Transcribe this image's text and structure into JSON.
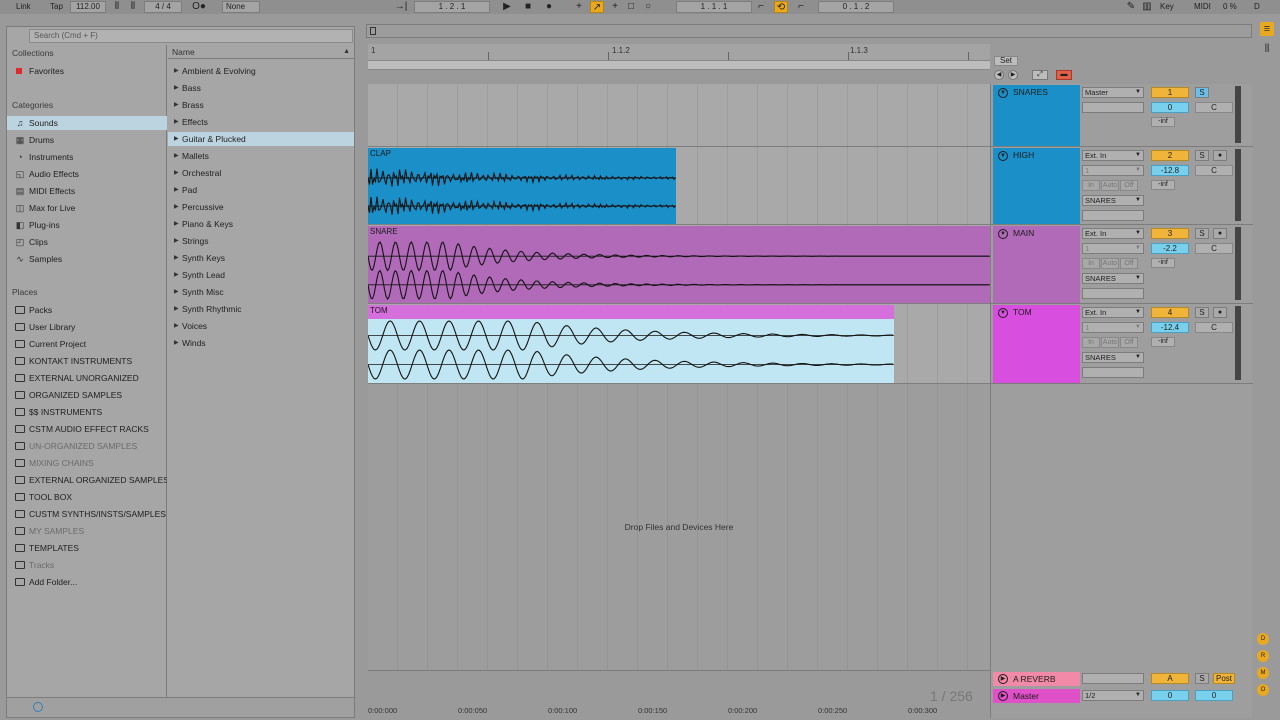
{
  "transport": {
    "link": "Link",
    "tap": "Tap",
    "tempo": "112.00",
    "signature": "4 / 4",
    "metronome": "None",
    "position": "1 .   2 .   1",
    "loop_start": "1 .   1 .   1",
    "loop_length": "0 .   1 .   2",
    "key": "Key",
    "midi": "MIDI",
    "cpu": "0 %",
    "disk": "D"
  },
  "browser": {
    "search_placeholder": "Search (Cmd + F)",
    "collections_title": "Collections",
    "favorites": "Favorites",
    "categories_title": "Categories",
    "categories": [
      {
        "label": "Sounds",
        "icon": "music-note-icon"
      },
      {
        "label": "Drums",
        "icon": "drum-grid-icon"
      },
      {
        "label": "Instruments",
        "icon": "instrument-icon"
      },
      {
        "label": "Audio Effects",
        "icon": "audio-effect-icon"
      },
      {
        "label": "MIDI Effects",
        "icon": "midi-effect-icon"
      },
      {
        "label": "Max for Live",
        "icon": "max-icon"
      },
      {
        "label": "Plug-ins",
        "icon": "plugin-icon"
      },
      {
        "label": "Clips",
        "icon": "clip-icon"
      },
      {
        "label": "Samples",
        "icon": "waveform-icon"
      }
    ],
    "places_title": "Places",
    "places": [
      {
        "label": "Packs",
        "dim": false
      },
      {
        "label": "User Library",
        "dim": false
      },
      {
        "label": "Current Project",
        "dim": false
      },
      {
        "label": "KONTAKT INSTRUMENTS",
        "dim": false
      },
      {
        "label": "EXTERNAL UNORGANIZED",
        "dim": false
      },
      {
        "label": "ORGANIZED SAMPLES",
        "dim": false
      },
      {
        "label": "$$ INSTRUMENTS",
        "dim": false
      },
      {
        "label": "CSTM AUDIO EFFECT RACKS",
        "dim": false
      },
      {
        "label": "UN-ORGANIZED SAMPLES",
        "dim": true
      },
      {
        "label": "MIXING CHAINS",
        "dim": true
      },
      {
        "label": "EXTERNAL ORGANIZED SAMPLES",
        "dim": false
      },
      {
        "label": "TOOL BOX",
        "dim": false
      },
      {
        "label": "CUSTM SYNTHS/INSTS/SAMPLES",
        "dim": false
      },
      {
        "label": "MY SAMPLES",
        "dim": true
      },
      {
        "label": "TEMPLATES",
        "dim": false
      },
      {
        "label": "Tracks",
        "dim": true
      },
      {
        "label": "Add Folder...",
        "dim": false
      }
    ],
    "name_header": "Name",
    "names": [
      "Ambient & Evolving",
      "Bass",
      "Brass",
      "Effects",
      "Guitar & Plucked",
      "Mallets",
      "Orchestral",
      "Pad",
      "Percussive",
      "Piano & Keys",
      "Strings",
      "Synth Keys",
      "Synth Lead",
      "Synth Misc",
      "Synth Rhythmic",
      "Voices",
      "Winds"
    ],
    "selected_name": "Guitar & Plucked",
    "selected_category": "Sounds"
  },
  "arrangement": {
    "ruler": [
      "1",
      "1.1.2",
      "1.1.3"
    ],
    "set_label": "Set",
    "drop_hint": "Drop Files and Devices Here",
    "zoom_readout": "1 / 256",
    "time_labels": [
      "0:00:000",
      "0:00:050",
      "0:00:100",
      "0:00:150",
      "0:00:200",
      "0:00:250",
      "0:00:300"
    ],
    "clips": [
      {
        "name": "CLAP",
        "color": "#1a8fc8"
      },
      {
        "name": "SNARE",
        "color": "#b06ab8"
      },
      {
        "name": "TOM",
        "color": "#d46fdc"
      }
    ]
  },
  "tracks": [
    {
      "name": "SNARES",
      "color": "#1a8fc8",
      "input": "Master",
      "input2": "",
      "output": "",
      "number": "1",
      "volume": "0",
      "pan": "C",
      "send": "-inf",
      "solo_on": true
    },
    {
      "name": "HIGH",
      "color": "#1a8fc8",
      "input": "Ext. In",
      "input2": "1",
      "output": "SNARES",
      "number": "2",
      "volume": "-12.8",
      "pan": "C",
      "send": "-inf",
      "solo_on": false
    },
    {
      "name": "MAIN",
      "color": "#b06ab8",
      "input": "Ext. In",
      "input2": "1",
      "output": "SNARES",
      "number": "3",
      "volume": "-2.2",
      "pan": "C",
      "send": "-inf",
      "solo_on": false
    },
    {
      "name": "TOM",
      "color": "#d84fe0",
      "input": "Ext. In",
      "input2": "1",
      "output": "SNARES",
      "number": "4",
      "volume": "-12.4",
      "pan": "C",
      "send": "-inf",
      "solo_on": false
    }
  ],
  "monitor": {
    "in": "In",
    "auto": "Auto",
    "off": "Off"
  },
  "returns": {
    "reverb": {
      "name": "A REVERB",
      "color": "#f08aa8",
      "letter": "A",
      "solo": "S",
      "post": "Post"
    },
    "master": {
      "name": "Master",
      "color": "#e050c8",
      "output": "1/2",
      "volume": "0",
      "pan": "0"
    }
  },
  "solo_label": "S",
  "side_dots": [
    "D",
    "R",
    "M",
    "O"
  ]
}
